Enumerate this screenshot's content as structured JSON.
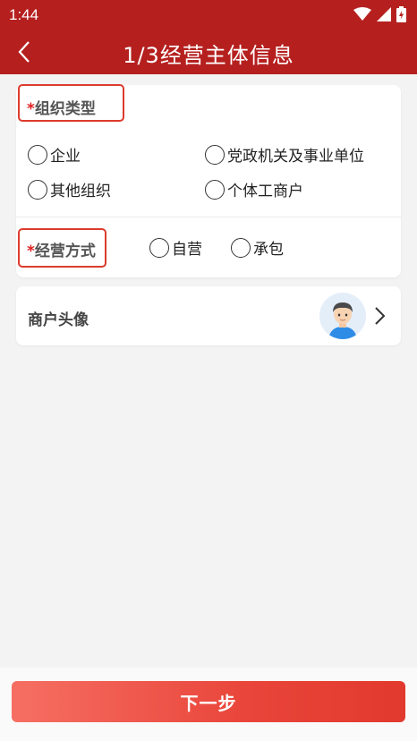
{
  "status_bar": {
    "time": "1:44",
    "icons": [
      "wifi-icon",
      "signal-icon",
      "battery-icon"
    ]
  },
  "header": {
    "title": "1/3经营主体信息",
    "back_icon": "chevron-left-icon",
    "bg_color": "#b5201f"
  },
  "org_type": {
    "required_mark": "*",
    "label": "组织类型",
    "options": [
      "企业",
      "党政机关及事业单位",
      "其他组织",
      "个体工商户"
    ]
  },
  "business_mode": {
    "required_mark": "*",
    "label": "经营方式",
    "options": [
      "自营",
      "承包"
    ]
  },
  "avatar_row": {
    "label": "商户头像",
    "avatar_icon": "user-avatar-icon",
    "chevron_icon": "chevron-right-icon"
  },
  "footer": {
    "next_label": "下一步",
    "accent_color": "#e9453a"
  }
}
